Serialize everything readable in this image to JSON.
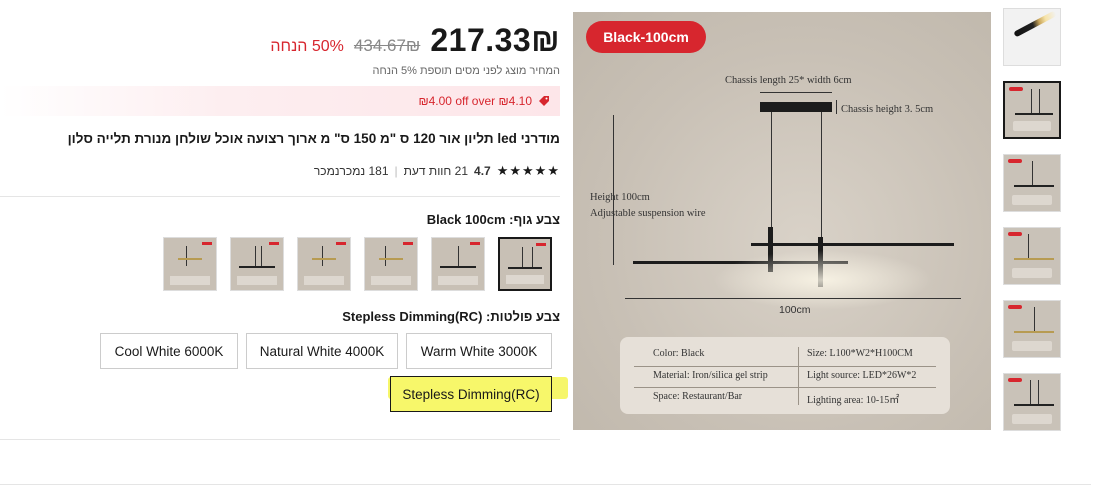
{
  "product": {
    "price": "217.33₪",
    "old_price": "434.67₪",
    "discount": "50% הנחה",
    "tax_note": "המחיר מוצג לפני מסים תוספת 5% הנחה",
    "promo": "₪4.00 off over ₪4.10",
    "title": "מודרני led תליון אור 120 ס \"מ 150 ס\" מ ארוך רצועה אוכל שולחן מנורת תלייה סלון",
    "rating": "4.7",
    "stars": "★★★★★",
    "reviews": "21 חוות דעת",
    "sold": "181 נמכרנמכר"
  },
  "body_color": {
    "label": "צבע גוף: Black 100cm",
    "swatch_count": 6
  },
  "light_color": {
    "label": "צבע פולטות: Stepless Dimming(RC)",
    "options": [
      "Warm White 3000K",
      "Natural White 4000K",
      "Cool White 6000K",
      "Stepless Dimming(RC)"
    ],
    "selected": "Stepless Dimming(RC)"
  },
  "main_image": {
    "badge": "Black-100cm",
    "chassis_length": "Chassis length 25* width 6cm",
    "chassis_height": "Chassis height 3. 5cm",
    "height": "Height 100cm",
    "suspension": "Adjustable suspension wire",
    "width": "100cm",
    "specs": {
      "color": "Color: Black",
      "size": "Size: L100*W2*H100CM",
      "material": "Material: Iron/silica gel strip",
      "light_source": "Light source: LED*26W*2",
      "space": "Space: Restaurant/Bar",
      "lighting_area": "Lighting area: 10-15㎡"
    }
  },
  "colors": {
    "accent": "#d7262e",
    "highlight": "#f5f550",
    "text": "#191919"
  }
}
